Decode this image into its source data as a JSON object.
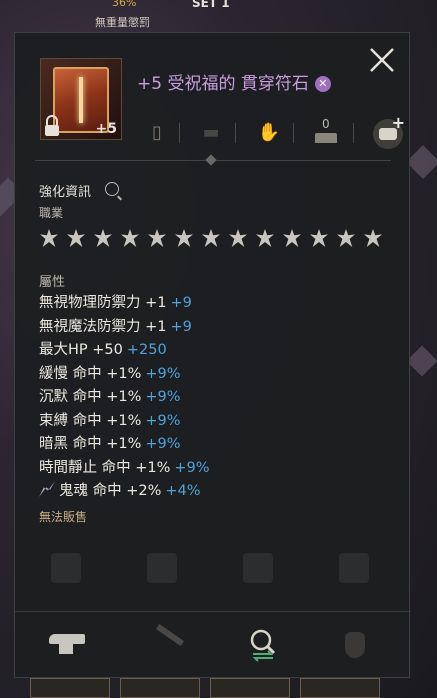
{
  "background": {
    "weight_text": "無重量懲罰",
    "pct_text": "36%",
    "set_text": "SET 1"
  },
  "item": {
    "title": "+5 受祝福的 貫穿符石",
    "badge": "✕",
    "plus_level": "+5",
    "icon": "rune-book-icon",
    "locked": true
  },
  "quick_bar": {
    "count": "0",
    "icons": [
      "card-icon",
      "lock-box-icon",
      "hand-icon",
      "anvil-icon",
      "chat-add-icon"
    ]
  },
  "enhance": {
    "label": "強化資訊",
    "jobs_label": "職業"
  },
  "classes": [
    "class-1-icon",
    "class-2-icon",
    "class-3-icon",
    "class-4-icon",
    "class-5-icon",
    "class-6-icon",
    "class-7-icon",
    "class-8-icon",
    "class-9-icon",
    "class-10-icon",
    "class-11-icon",
    "class-12-icon",
    "class-13-icon"
  ],
  "attributes": {
    "label": "屬性",
    "items": [
      {
        "text": "無視物理防禦力 +1",
        "bonus": "+9"
      },
      {
        "text": "無視魔法防禦力 +1",
        "bonus": "+9"
      },
      {
        "text": "最大HP +50",
        "bonus": "+250"
      },
      {
        "text": "緩慢 命中 +1%",
        "bonus": "+9%"
      },
      {
        "text": "沉默 命中 +1%",
        "bonus": "+9%"
      },
      {
        "text": "束縛 命中 +1%",
        "bonus": "+9%"
      },
      {
        "text": "暗黑 命中 +1%",
        "bonus": "+9%"
      },
      {
        "text": "時間靜止 命中 +1%",
        "bonus": "+9%"
      },
      {
        "text": "鬼魂 命中 +2%",
        "bonus": "+4%"
      }
    ]
  },
  "unsellable": "無法販售",
  "bottom_actions": [
    "anvil-icon",
    "tool-icon",
    "search-swap-icon",
    "vase-icon"
  ],
  "colors": {
    "title": "#c89ee0",
    "bonus": "#4fa3d8",
    "unsellable": "#c8b088"
  }
}
